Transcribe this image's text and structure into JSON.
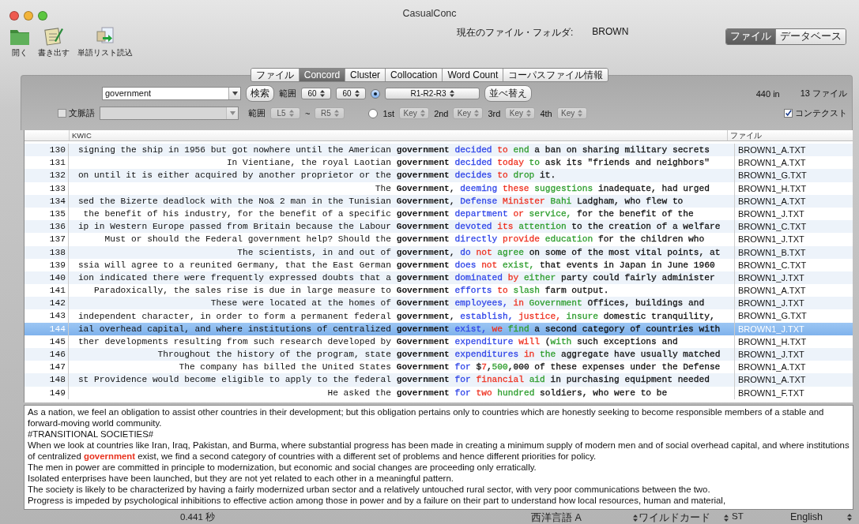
{
  "window": {
    "title": "CasualConc"
  },
  "toolbar": {
    "items": [
      {
        "label": "開く",
        "kind": "folder"
      },
      {
        "label": "書き出す",
        "kind": "notepad"
      },
      {
        "label": "単語リスト読込",
        "kind": "import"
      }
    ],
    "folder_label": "現在のファイル・フォルダ:",
    "folder_value": "BROWN",
    "mode": [
      {
        "label": "ファイル",
        "selected": true
      },
      {
        "label": "データベース",
        "selected": false
      }
    ]
  },
  "tabs": [
    {
      "label": "ファイル",
      "selected": false
    },
    {
      "label": "Concord",
      "selected": true
    },
    {
      "label": "Cluster",
      "selected": false
    },
    {
      "label": "Collocation",
      "selected": false
    },
    {
      "label": "Word Count",
      "selected": false
    },
    {
      "label": "コーパスファイル情報",
      "selected": false
    }
  ],
  "search": {
    "value": "government",
    "button": "検索",
    "span_label": "範囲",
    "span_left": {
      "value": "60",
      "disabled": false
    },
    "span_right": {
      "value": "60",
      "disabled": false
    },
    "sort_radio_selected": true,
    "sort_order": {
      "value": "R1-R2-R3",
      "disabled": false
    },
    "sort_button": "並べ替え",
    "hits": "440 in",
    "files": "13 ファイル"
  },
  "context_word": {
    "label": "文脈語",
    "checked": false,
    "disabled": true,
    "span_label": "範囲",
    "span_left": {
      "value": "L5",
      "disabled": true
    },
    "tilde": "~",
    "span_right": {
      "value": "R5",
      "disabled": true
    },
    "key_radio_selected": false,
    "keys": [
      {
        "label": "1st",
        "value": "Key",
        "disabled": true
      },
      {
        "label": "2nd",
        "value": "Key",
        "disabled": true
      },
      {
        "label": "3rd",
        "value": "Key",
        "disabled": true
      },
      {
        "label": "4th",
        "value": "Key",
        "disabled": true
      }
    ],
    "show_context": {
      "label": "コンテクスト",
      "checked": true
    }
  },
  "table": {
    "columns": [
      "KWIC",
      "ファイル"
    ],
    "rows": [
      {
        "n": "130",
        "left": "signing the ship in 1956 but got nowhere until the American",
        "node": "government",
        "right": [
          {
            "text": "decided",
            "color": "#3046e8"
          },
          {
            "text": "to",
            "color": "#ee3322"
          },
          {
            "text": "end",
            "color": "#2f9e2f"
          },
          {
            "text": "a ban on sharing military secrets",
            "color": "#111111"
          }
        ],
        "file": "BROWN1_A.TXT",
        "selected": false
      },
      {
        "n": "131",
        "left": "In Vientiane, the royal Laotian",
        "node": "government",
        "right": [
          {
            "text": "decided",
            "color": "#3046e8"
          },
          {
            "text": "today",
            "color": "#ee3322"
          },
          {
            "text": "to",
            "color": "#2f9e2f"
          },
          {
            "text": "ask its \"friends and neighbors\"",
            "color": "#111111"
          }
        ],
        "file": "BROWN1_A.TXT",
        "selected": false
      },
      {
        "n": "132",
        "left": "on until it is either acquired by another proprietor or the",
        "node": "government",
        "right": [
          {
            "text": "decides",
            "color": "#3046e8"
          },
          {
            "text": "to",
            "color": "#ee3322"
          },
          {
            "text": "drop",
            "color": "#2f9e2f"
          },
          {
            "text": "it.",
            "color": "#111111"
          }
        ],
        "file": "BROWN1_G.TXT",
        "selected": false
      },
      {
        "n": "133",
        "left": "The",
        "node": "Government,",
        "right": [
          {
            "text": "deeming",
            "color": "#3046e8"
          },
          {
            "text": "these",
            "color": "#ee3322"
          },
          {
            "text": "suggestions",
            "color": "#2f9e2f"
          },
          {
            "text": "inadequate, had urged",
            "color": "#111111"
          }
        ],
        "file": "BROWN1_H.TXT",
        "selected": false
      },
      {
        "n": "134",
        "left": "sed the Bizerte deadlock with the No& 2 man in the Tunisian",
        "node": "Government,",
        "right": [
          {
            "text": "Defense",
            "color": "#3046e8"
          },
          {
            "text": "Minister",
            "color": "#ee3322"
          },
          {
            "text": "Bahi",
            "color": "#2f9e2f"
          },
          {
            "text": "Ladgham, who flew to",
            "color": "#111111"
          }
        ],
        "file": "BROWN1_A.TXT",
        "selected": false
      },
      {
        "n": "135",
        "left": "the benefit of his industry, for the benefit of a specific",
        "node": "government",
        "right": [
          {
            "text": "department",
            "color": "#3046e8"
          },
          {
            "text": "or",
            "color": "#ee3322"
          },
          {
            "text": "service,",
            "color": "#2f9e2f"
          },
          {
            "text": "for the benefit of the",
            "color": "#111111"
          }
        ],
        "file": "BROWN1_J.TXT",
        "selected": false
      },
      {
        "n": "136",
        "left": "ip in Western Europe passed from Britain because the Labour",
        "node": "Government",
        "right": [
          {
            "text": "devoted",
            "color": "#3046e8"
          },
          {
            "text": "its",
            "color": "#ee3322"
          },
          {
            "text": "attention",
            "color": "#2f9e2f"
          },
          {
            "text": "to the creation of a welfare",
            "color": "#111111"
          }
        ],
        "file": "BROWN1_C.TXT",
        "selected": false
      },
      {
        "n": "137",
        "left": "Must or should the Federal government help? Should the",
        "node": "government",
        "right": [
          {
            "text": "directly",
            "color": "#3046e8"
          },
          {
            "text": "provide",
            "color": "#ee3322"
          },
          {
            "text": "education",
            "color": "#2f9e2f"
          },
          {
            "text": "for the children who",
            "color": "#111111"
          }
        ],
        "file": "BROWN1_J.TXT",
        "selected": false
      },
      {
        "n": "138",
        "left": "The scientists, in and out of",
        "node": "government,",
        "right": [
          {
            "text": "do",
            "color": "#3046e8"
          },
          {
            "text": "not",
            "color": "#ee3322"
          },
          {
            "text": "agree",
            "color": "#2f9e2f"
          },
          {
            "text": "on some of the most vital points, at",
            "color": "#111111"
          }
        ],
        "file": "BROWN1_B.TXT",
        "selected": false
      },
      {
        "n": "139",
        "left": "ssia will agree to a reunited Germany, that the East German",
        "node": "government",
        "right": [
          {
            "text": "does",
            "color": "#3046e8"
          },
          {
            "text": "not",
            "color": "#ee3322"
          },
          {
            "text": "exist,",
            "color": "#2f9e2f"
          },
          {
            "text": "that events in Japan in June 1960",
            "color": "#111111"
          }
        ],
        "file": "BROWN1_C.TXT",
        "selected": false
      },
      {
        "n": "140",
        "left": "ion indicated there were frequently expressed doubts that a",
        "node": "government",
        "right": [
          {
            "text": "dominated",
            "color": "#3046e8"
          },
          {
            "text": "by",
            "color": "#ee3322"
          },
          {
            "text": "either",
            "color": "#2f9e2f"
          },
          {
            "text": "party could fairly administer",
            "color": "#111111"
          }
        ],
        "file": "BROWN1_J.TXT",
        "selected": false
      },
      {
        "n": "141",
        "left": "Paradoxically, the sales rise is due in large measure to",
        "node": "Government",
        "right": [
          {
            "text": "efforts",
            "color": "#3046e8"
          },
          {
            "text": "to",
            "color": "#ee3322"
          },
          {
            "text": "slash",
            "color": "#2f9e2f"
          },
          {
            "text": "farm output.",
            "color": "#111111"
          }
        ],
        "file": "BROWN1_A.TXT",
        "selected": false
      },
      {
        "n": "142",
        "left": "These were located at the homes of",
        "node": "Government",
        "right": [
          {
            "text": "employees,",
            "color": "#3046e8"
          },
          {
            "text": "in",
            "color": "#ee3322"
          },
          {
            "text": "Government",
            "color": "#2f9e2f"
          },
          {
            "text": "Offices, buildings and",
            "color": "#111111"
          }
        ],
        "file": "BROWN1_J.TXT",
        "selected": false
      },
      {
        "n": "143",
        "left": "independent character, in order to form a permanent federal",
        "node": "government,",
        "right": [
          {
            "text": "establish,",
            "color": "#3046e8"
          },
          {
            "text": "justice,",
            "color": "#ee3322"
          },
          {
            "text": "insure",
            "color": "#2f9e2f"
          },
          {
            "text": "domestic tranquility,",
            "color": "#111111"
          }
        ],
        "file": "BROWN1_G.TXT",
        "selected": false
      },
      {
        "n": "144",
        "left": "ial overhead capital, and where institutions of centralized",
        "node": "government",
        "right": [
          {
            "text": "exist,",
            "color": "#3046e8"
          },
          {
            "text": "we",
            "color": "#ee3322"
          },
          {
            "text": "find",
            "color": "#2f9e2f"
          },
          {
            "text": "a second category of countries with",
            "color": "#111111"
          }
        ],
        "file": "BROWN1_J.TXT",
        "selected": true
      },
      {
        "n": "145",
        "left": "ther developments resulting from such research developed by",
        "node": "Government",
        "right": [
          {
            "text": "expenditure",
            "color": "#3046e8"
          },
          {
            "text": "will",
            "color": "#ee3322"
          },
          {
            "text": "("
          },
          {
            "text": "with",
            "color": "#2f9e2f",
            "attached": true
          },
          {
            "text": "such exceptions and",
            "color": "#111111"
          }
        ],
        "file": "BROWN1_H.TXT",
        "selected": false
      },
      {
        "n": "146",
        "left": "Throughout the history of the program, state",
        "node": "government",
        "right": [
          {
            "text": "expenditures",
            "color": "#3046e8"
          },
          {
            "text": "in",
            "color": "#ee3322"
          },
          {
            "text": "the",
            "color": "#2f9e2f"
          },
          {
            "text": "aggregate have usually matched",
            "color": "#111111"
          }
        ],
        "file": "BROWN1_J.TXT",
        "selected": false
      },
      {
        "n": "147",
        "left": "The company has billed the United States",
        "node": "Government",
        "right": [
          {
            "text": "for",
            "color": "#3046e8"
          },
          {
            "text": "$"
          },
          {
            "text": "7",
            "color": "#ee3322",
            "attached": true
          },
          {
            "text": ",",
            "attached": true
          },
          {
            "text": "500",
            "color": "#2f9e2f",
            "attached": true
          },
          {
            "text": ",000 of these expenses under the Defense",
            "color": "#111111",
            "attached": true
          }
        ],
        "file": "BROWN1_A.TXT",
        "selected": false
      },
      {
        "n": "148",
        "left": "st Providence would become eligible to apply to the federal",
        "node": "government",
        "right": [
          {
            "text": "for",
            "color": "#3046e8"
          },
          {
            "text": "financial",
            "color": "#ee3322"
          },
          {
            "text": "aid",
            "color": "#2f9e2f"
          },
          {
            "text": "in purchasing equipment needed",
            "color": "#111111"
          }
        ],
        "file": "BROWN1_A.TXT",
        "selected": false
      },
      {
        "n": "149",
        "left": "He asked the",
        "node": "government",
        "right": [
          {
            "text": "for",
            "color": "#3046e8"
          },
          {
            "text": "two",
            "color": "#ee3322"
          },
          {
            "text": "hundred",
            "color": "#2f9e2f"
          },
          {
            "text": "soldiers, who were to be",
            "color": "#111111"
          }
        ],
        "file": "BROWN1_F.TXT",
        "selected": false
      }
    ]
  },
  "context": [
    {
      "text": "As a nation, we feel an obligation to assist other countries in their development; but this obligation pertains only to countries which are honestly seeking to become responsible members of a stable and forward-moving world community."
    },
    {
      "text": "#TRANSITIONAL SOCIETIES#"
    },
    {
      "before": "When we look at countries like Iran, Iraq, Pakistan, and Burma, where substantial progress has been made in creating a minimum supply of modern men and of social overhead capital, and where institutions of centralized ",
      "hit": "government",
      "after": " exist, we find a second category of countries with a different set of problems and hence different priorities for policy."
    },
    {
      "text": "The men in power are committed in principle to modernization, but economic and social changes are proceeding only erratically."
    },
    {
      "text": "Isolated enterprises have been launched, but they are not yet related to each other in a meaningful pattern."
    },
    {
      "text": "The society is likely to be characterized by having a fairly modernized urban sector and a relatively untouched rural sector, with very poor communications between the two."
    },
    {
      "text": "Progress is impeded by psychological inhibitions to effective action among those in power and by a failure on their part to understand how local resources, human and material,"
    }
  ],
  "status_bar": {
    "time": "0.441 秒",
    "language": "西洋言語 A",
    "wildcard": "ワイルドカード",
    "wildcard_value": "ST",
    "ui_language": "English"
  }
}
